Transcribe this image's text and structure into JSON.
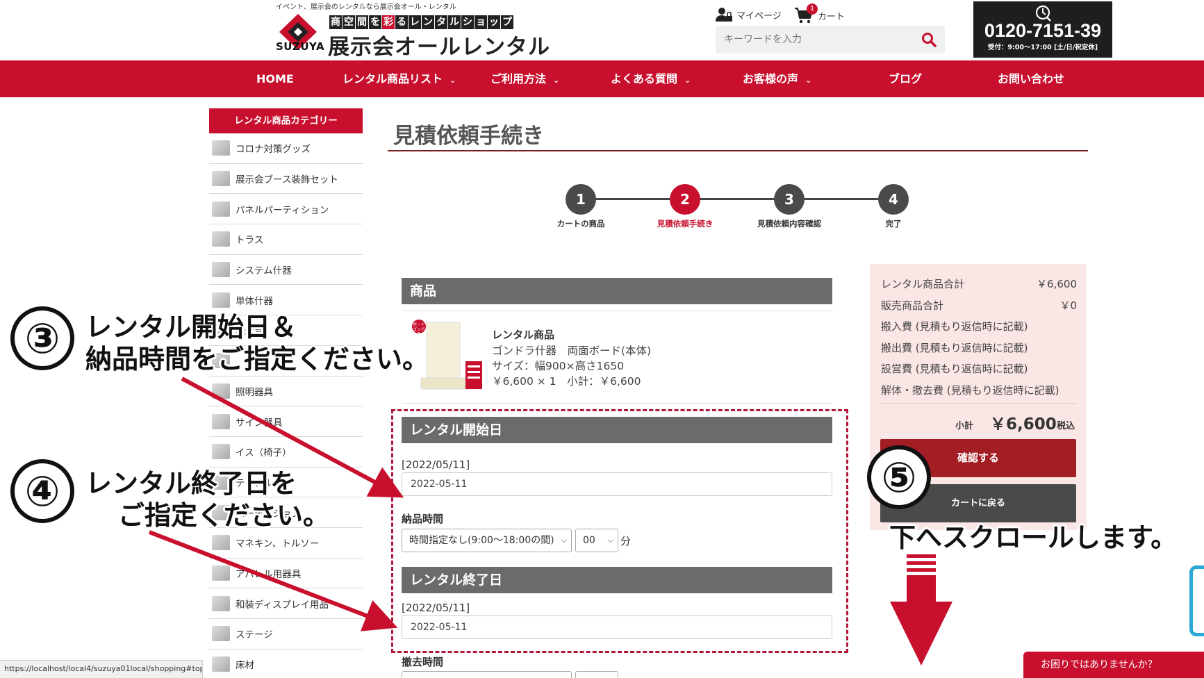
{
  "header": {
    "tagline": "イベント、展示会のレンタルなら展示会オール・レンタル",
    "brand_short": "SUZUYA",
    "logo_sub_chars": [
      "商",
      "空",
      "間",
      "を",
      "彩",
      "る",
      "レ",
      "ン",
      "タ",
      "ル",
      "シ",
      "ョ",
      "ッ",
      "プ"
    ],
    "logo_main": "展示会オールレンタル",
    "mypage_label": "マイページ",
    "cart_label": "カート",
    "cart_count": "1",
    "search_placeholder": "キーワードを入力",
    "phone_number": "0120-7151-39",
    "phone_hours": "受付：9:00～17:00 [土/日/祝定休]"
  },
  "nav": {
    "items": [
      {
        "label": "HOME",
        "has_dropdown": false
      },
      {
        "label": "レンタル商品リスト",
        "has_dropdown": true
      },
      {
        "label": "ご利用方法",
        "has_dropdown": true
      },
      {
        "label": "よくある質問",
        "has_dropdown": true
      },
      {
        "label": "お客様の声",
        "has_dropdown": true
      },
      {
        "label": "ブログ",
        "has_dropdown": false
      },
      {
        "label": "お問い合わせ",
        "has_dropdown": false
      }
    ]
  },
  "sidebar": {
    "heading": "レンタル商品カテゴリー",
    "items": [
      {
        "label": "コロナ対策グッズ"
      },
      {
        "label": "展示会ブース装飾セット"
      },
      {
        "label": "パネルパーティション"
      },
      {
        "label": "トラス"
      },
      {
        "label": "システム什器"
      },
      {
        "label": "単体什器"
      },
      {
        "label": "展示台"
      },
      {
        "label": ""
      },
      {
        "label": "照明器具"
      },
      {
        "label": "サイン器具"
      },
      {
        "label": "イス（椅子）"
      },
      {
        "label": "テーブル"
      },
      {
        "label": "パーテーション"
      },
      {
        "label": "マネキン、トルソー"
      },
      {
        "label": "アパレル用器具"
      },
      {
        "label": "和装ディスプレイ用品"
      },
      {
        "label": "ステージ"
      },
      {
        "label": "床材"
      }
    ]
  },
  "main": {
    "title": "見積依頼手続き",
    "steps": [
      {
        "num": "1",
        "label": "カートの商品",
        "active": false
      },
      {
        "num": "2",
        "label": "見積依頼手続き",
        "active": true
      },
      {
        "num": "3",
        "label": "見積依頼内容確認",
        "active": false
      },
      {
        "num": "4",
        "label": "完了",
        "active": false
      }
    ],
    "product_section": "商品",
    "product": {
      "category": "レンタル商品",
      "name": "ゴンドラ什器　両面ボード(本体)",
      "size": "サイズ：幅900×高さ1650",
      "price_line": "￥6,600 × 1　小計：￥6,600",
      "badge": "ボード ゴンドラ"
    },
    "start_section": "レンタル開始日",
    "start_date_label": "[2022/05/11]",
    "start_date_value": "2022-05-11",
    "delivery_time_label": "納品時間",
    "delivery_time_select": "時間指定なし(9:00～18:00の間)",
    "delivery_minute_select": "00",
    "minute_unit": "分",
    "end_section": "レンタル終了日",
    "end_date_label": "[2022/05/11]",
    "end_date_value": "2022-05-11",
    "removal_time_label": "撤去時間"
  },
  "summary": {
    "rows": [
      {
        "label": "レンタル商品合計",
        "value": "￥6,600"
      },
      {
        "label": "販売商品合計",
        "value": "￥0"
      },
      {
        "label": "搬入費 (見積もり返信時に記載)",
        "value": ""
      },
      {
        "label": "搬出費 (見積もり返信時に記載)",
        "value": ""
      },
      {
        "label": "設営費 (見積もり返信時に記載)",
        "value": ""
      },
      {
        "label": "解体・撤去費 (見積もり返信時に記載)",
        "value": ""
      }
    ],
    "subtotal_label": "小計",
    "subtotal_value": "￥6,600",
    "subtotal_tax": "税込",
    "confirm_button": "確認する",
    "back_button": "カートに戻る"
  },
  "annotations": {
    "step3_number": "③",
    "step3_line1": "レンタル開始日＆",
    "step3_line2": "納品時間をご指定ください。",
    "step4_number": "④",
    "step4_line1": "レンタル終了日を",
    "step4_line2": "ご指定ください。",
    "step5_number": "⑤",
    "step5_text": "下へスクロールします。"
  },
  "status_bar": {
    "url": "https://localhost/local4/suzuya01local/shopping#top"
  },
  "help_tab": "お困りではありませんか？",
  "colors": {
    "brand_red": "#c8102e",
    "dark_red_button": "#a31d24",
    "section_gray": "#6b6b6b",
    "summary_bg": "#fbe6e6",
    "arrow_red": "#c8102e",
    "dashed_border": "#b0163a"
  }
}
